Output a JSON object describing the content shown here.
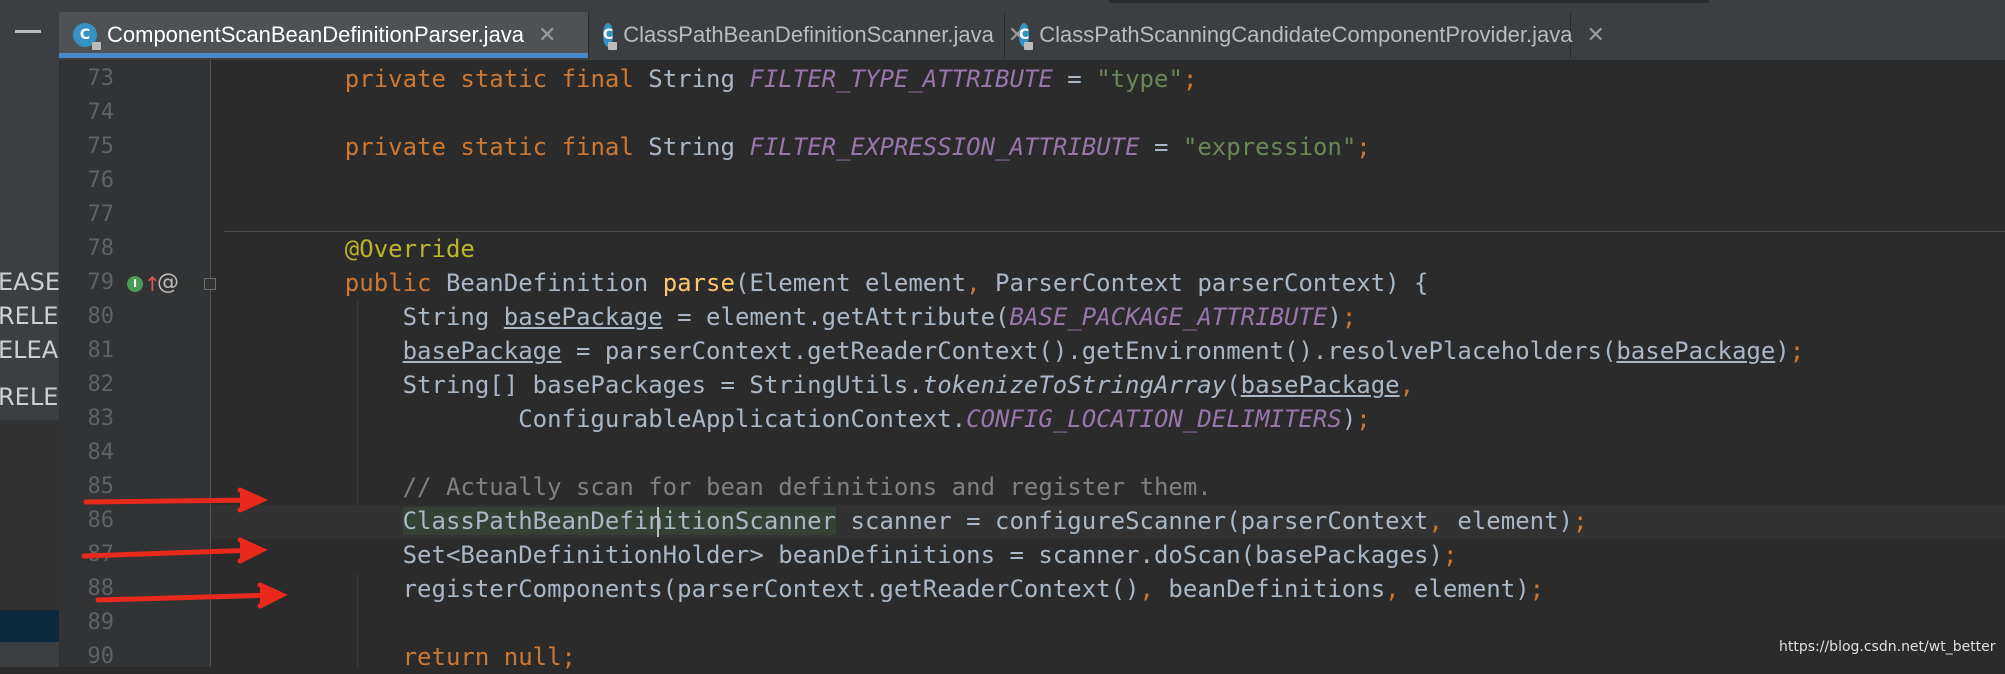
{
  "sidebar": {
    "labels": [
      "EASE",
      "RELE",
      "ELEA",
      "RELE"
    ]
  },
  "tabs": [
    {
      "label": "ComponentScanBeanDefinitionParser.java",
      "icon_letter": "C",
      "active": true
    },
    {
      "label": "ClassPathBeanDefinitionScanner.java",
      "icon_letter": "C",
      "active": false
    },
    {
      "label": "ClassPathScanningCandidateComponentProvider.java",
      "icon_letter": "C",
      "active": false
    }
  ],
  "editor": {
    "lines": [
      {
        "num": "73",
        "tokens": [
          [
            "    ",
            ""
          ],
          [
            "private",
            "kw"
          ],
          [
            " ",
            ""
          ],
          [
            "static",
            "kw"
          ],
          [
            " ",
            ""
          ],
          [
            "final",
            "kw"
          ],
          [
            " String ",
            ""
          ],
          [
            "FILTER_TYPE_ATTRIBUTE",
            "const"
          ],
          [
            " = ",
            ""
          ],
          [
            "\"type\"",
            "str"
          ],
          [
            ";",
            "kw"
          ]
        ]
      },
      {
        "num": "74",
        "tokens": []
      },
      {
        "num": "75",
        "tokens": [
          [
            "    ",
            ""
          ],
          [
            "private",
            "kw"
          ],
          [
            " ",
            ""
          ],
          [
            "static",
            "kw"
          ],
          [
            " ",
            ""
          ],
          [
            "final",
            "kw"
          ],
          [
            " String ",
            ""
          ],
          [
            "FILTER_EXPRESSION_ATTRIBUTE",
            "const"
          ],
          [
            " = ",
            ""
          ],
          [
            "\"expression\"",
            "str"
          ],
          [
            ";",
            "kw"
          ]
        ]
      },
      {
        "num": "76",
        "tokens": []
      },
      {
        "num": "77",
        "tokens": []
      },
      {
        "num": "78",
        "tokens": [
          [
            "    ",
            ""
          ],
          [
            "@Override",
            "anno"
          ]
        ]
      },
      {
        "num": "79",
        "tokens": [
          [
            "    ",
            ""
          ],
          [
            "public",
            "kw"
          ],
          [
            " BeanDefinition ",
            ""
          ],
          [
            "parse",
            "fn"
          ],
          [
            "(Element element",
            ""
          ],
          [
            ",",
            "kw"
          ],
          [
            " ParserContext parserContext) {",
            ""
          ]
        ]
      },
      {
        "num": "80",
        "tokens": [
          [
            "        String ",
            ""
          ],
          [
            "basePackage",
            "ul"
          ],
          [
            " = element.getAttribute(",
            ""
          ],
          [
            "BASE_PACKAGE_ATTRIBUTE",
            "const"
          ],
          [
            ")",
            ""
          ],
          [
            ";",
            "kw"
          ]
        ]
      },
      {
        "num": "81",
        "tokens": [
          [
            "        ",
            ""
          ],
          [
            "basePackage",
            "ul"
          ],
          [
            " = parserContext.getReaderContext().getEnvironment().resolvePlaceholders(",
            ""
          ],
          [
            "basePackage",
            "ul"
          ],
          [
            ")",
            ""
          ],
          [
            ";",
            "kw"
          ]
        ]
      },
      {
        "num": "82",
        "tokens": [
          [
            "        String[] basePackages = StringUtils.",
            ""
          ],
          [
            "tokenizeToStringArray",
            "ital"
          ],
          [
            "(",
            ""
          ],
          [
            "basePackage",
            "ul"
          ],
          [
            ",",
            "kw"
          ]
        ]
      },
      {
        "num": "83",
        "tokens": [
          [
            "                ConfigurableApplicationContext.",
            ""
          ],
          [
            "CONFIG_LOCATION_DELIMITERS",
            "const"
          ],
          [
            ")",
            ""
          ],
          [
            ";",
            "kw"
          ]
        ]
      },
      {
        "num": "84",
        "tokens": []
      },
      {
        "num": "85",
        "tokens": [
          [
            "        ",
            ""
          ],
          [
            "// Actually scan for bean definitions and register them.",
            "cmt"
          ]
        ]
      },
      {
        "num": "86",
        "tokens": [
          [
            "        ",
            ""
          ],
          [
            "ClassPathBeanDefinitionScanner",
            "hl-word"
          ],
          [
            " scanner = configureScanner(parserContext",
            ""
          ],
          [
            ",",
            "kw"
          ],
          [
            " element)",
            ""
          ],
          [
            ";",
            "kw"
          ]
        ]
      },
      {
        "num": "87",
        "tokens": [
          [
            "        Set<BeanDefinitionHolder> beanDefinitions = scanner.doScan(basePackages)",
            ""
          ],
          [
            ";",
            "kw"
          ]
        ]
      },
      {
        "num": "88",
        "tokens": [
          [
            "        registerComponents(parserContext.getReaderContext()",
            ""
          ],
          [
            ",",
            "kw"
          ],
          [
            " beanDefinitions",
            ""
          ],
          [
            ",",
            "kw"
          ],
          [
            " element)",
            ""
          ],
          [
            ";",
            "kw"
          ]
        ]
      },
      {
        "num": "89",
        "tokens": []
      },
      {
        "num": "90",
        "tokens": [
          [
            "        ",
            ""
          ],
          [
            "return",
            "kw"
          ],
          [
            " ",
            ""
          ],
          [
            "null",
            "kw"
          ],
          [
            ";",
            "kw"
          ]
        ]
      }
    ]
  },
  "gutter_icons": {
    "line79": [
      "implements-icon",
      "override-up-icon",
      "at-icon"
    ],
    "line86": [
      "lightbulb-icon"
    ]
  },
  "watermark": "https://blog.csdn.net/wt_better",
  "colors": {
    "keyword": "#cc7832",
    "string": "#6a8759",
    "constant": "#9876aa",
    "annotation": "#bbb529",
    "function": "#ffc66d",
    "comment": "#808080",
    "arrow": "#e8291c"
  }
}
